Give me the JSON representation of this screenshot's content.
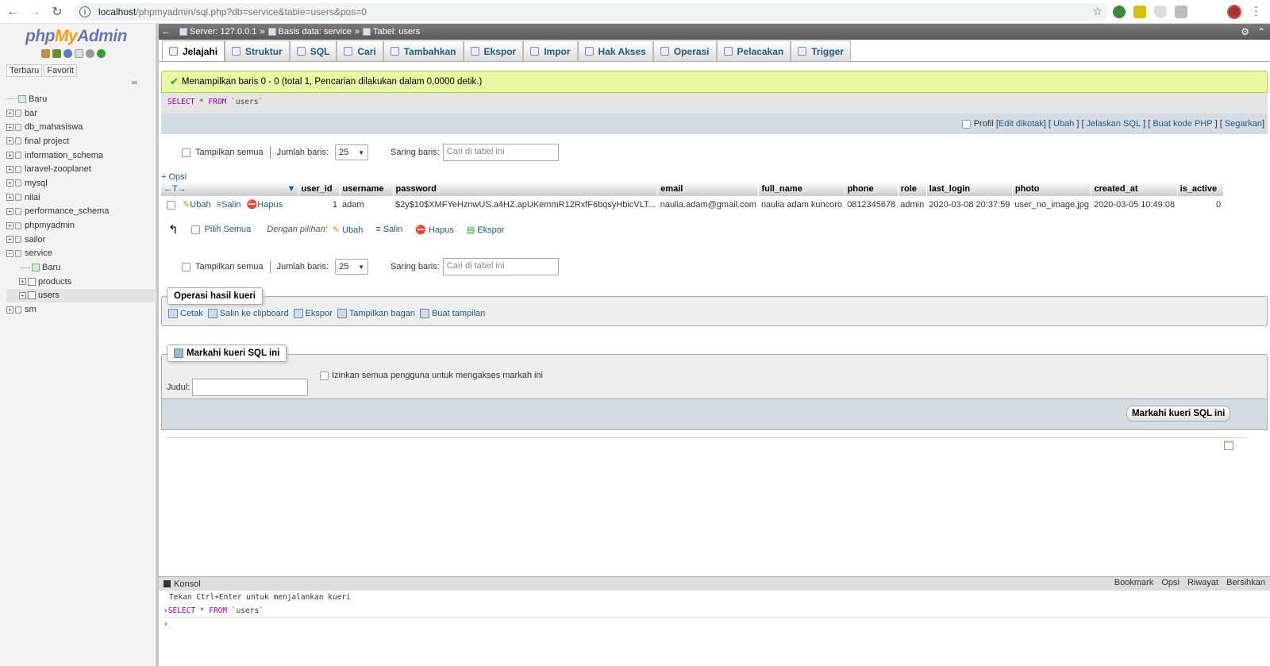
{
  "browser": {
    "url_host": "localhost",
    "url_rest": "/phpmyadmin/sql.php?db=service&table=users&pos=0"
  },
  "logo": {
    "php": "php",
    "my": "My",
    "admin": "Admin"
  },
  "leftnav": {
    "tabs": [
      "Terbaru",
      "Favorit"
    ],
    "tree": [
      {
        "label": "Baru",
        "type": "new",
        "level": 0
      },
      {
        "label": "bar",
        "type": "db",
        "level": 0
      },
      {
        "label": "db_mahasiswa",
        "type": "db",
        "level": 0
      },
      {
        "label": "final project",
        "type": "db",
        "level": 0
      },
      {
        "label": "information_schema",
        "type": "db",
        "level": 0
      },
      {
        "label": "laravel-zooplanet",
        "type": "db",
        "level": 0
      },
      {
        "label": "mysql",
        "type": "db",
        "level": 0
      },
      {
        "label": "nilai",
        "type": "db",
        "level": 0
      },
      {
        "label": "performance_schema",
        "type": "db",
        "level": 0
      },
      {
        "label": "phpmyadmin",
        "type": "db",
        "level": 0
      },
      {
        "label": "sailor",
        "type": "db",
        "level": 0
      },
      {
        "label": "service",
        "type": "db-open",
        "level": 0
      },
      {
        "label": "Baru",
        "type": "new",
        "level": 1
      },
      {
        "label": "products",
        "type": "table",
        "level": 1
      },
      {
        "label": "users",
        "type": "table",
        "level": 1,
        "selected": true
      },
      {
        "label": "sm",
        "type": "db",
        "level": 0
      }
    ]
  },
  "topbar": {
    "server": "Server: 127.0.0.1",
    "database": "Basis data: service",
    "table": "Tabel: users"
  },
  "tabs": [
    {
      "label": "Jelajahi",
      "active": true
    },
    {
      "label": "Struktur"
    },
    {
      "label": "SQL"
    },
    {
      "label": "Cari"
    },
    {
      "label": "Tambahkan"
    },
    {
      "label": "Ekspor"
    },
    {
      "label": "Impor"
    },
    {
      "label": "Hak Akses"
    },
    {
      "label": "Operasi"
    },
    {
      "label": "Pelacakan"
    },
    {
      "label": "Trigger"
    }
  ],
  "message": "Menampilkan baris 0 - 0 (total 1, Pencarian dilakukan dalam 0,0000 detik.)",
  "sql": {
    "kw1": "SELECT",
    "rest1": " * ",
    "kw2": "FROM",
    "rest2": " `users`"
  },
  "sqlbar": {
    "profil": "Profil",
    "edit_inline": "Edit dikotak",
    "ubah": "Ubah",
    "jelaskan": "Jelaskan SQL",
    "buat_php": "Buat kode PHP",
    "segarkan": "Segarkan"
  },
  "nav": {
    "show_all": "Tampilkan semua",
    "rows_label": "Jumlah baris:",
    "rows_value": "25",
    "filter_label": "Saring baris:",
    "filter_placeholder": "Cari di tabel ini"
  },
  "opsi": "+ Opsi",
  "columns": [
    "user_id",
    "username",
    "password",
    "email",
    "full_name",
    "phone",
    "role",
    "last_login",
    "photo",
    "created_at",
    "is_active"
  ],
  "row": {
    "edit": "Ubah",
    "copy": "Salin",
    "delete": "Hapus",
    "user_id": "1",
    "username": "adam",
    "password": "$2y$10$XMFYeHznwUS.a4HZ.apUKemmR12RxfF6bqsyHbicVLT...",
    "email": "naulia.adam@gmail.com",
    "full_name": "naulia adam kuncoro",
    "phone": "0812345678",
    "role": "admin",
    "last_login": "2020-03-08 20:37:59",
    "photo": "user_no_image.jpg",
    "created_at": "2020-03-05 10:49:08",
    "is_active": "0"
  },
  "bulk": {
    "select_all": "Pilih Semua",
    "with_selected": "Dengan pilihan:",
    "edit": "Ubah",
    "copy": "Salin",
    "delete": "Hapus",
    "export": "Ekspor"
  },
  "query_ops": {
    "title": "Operasi hasil kueri",
    "print": "Cetak",
    "clipboard": "Salin ke clipboard",
    "export": "Ekspor",
    "chart": "Tampilkan bagan",
    "view": "Buat tampilan"
  },
  "bookmark": {
    "title": "Markahi kueri SQL ini",
    "label": "Judul:",
    "allow_all": "Izinkan semua pengguna untuk mengakses markah ini",
    "button": "Markahi kueri SQL ini"
  },
  "console": {
    "title": "Konsol",
    "links": [
      "Bookmark",
      "Opsi",
      "Riwayat",
      "Bersihkan"
    ],
    "hint": "Tekan Ctrl+Enter untuk menjalankan kueri",
    "kw1": "SELECT",
    "rest1": " * ",
    "kw2": "FROM",
    "rest2": " `users`"
  }
}
